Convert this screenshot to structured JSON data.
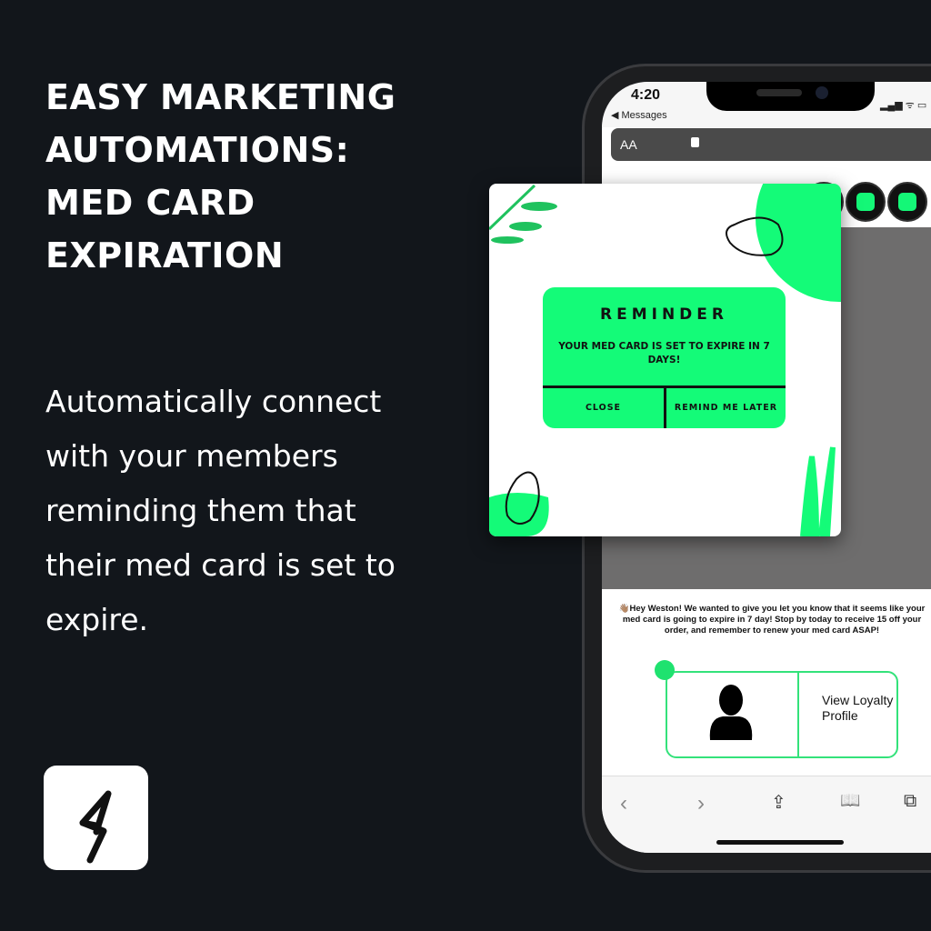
{
  "headline": {
    "lines": [
      "Easy Marketing",
      "Automations:",
      "Med Card",
      "Expiration"
    ]
  },
  "body": "Automatically connect with your members reminding them that their med card is set to expire.",
  "logo": {
    "icon": "lightning-bolt-icon"
  },
  "phone": {
    "status": {
      "time": "4:20",
      "back": "◀ Messages",
      "signal": "▂▄▆ ᯤ ▭"
    },
    "urlbar": {
      "text_size": "AA",
      "icon": "lock-icon"
    },
    "social_icons": [
      "facebook-icon",
      "instagram-icon",
      "cart-icon"
    ],
    "message": "👋🏽Hey Weston! We wanted to give you let you know that it seems like your med card is going to expire in 7 day! Stop by today to receive 15 off your order, and remember to renew your med card ASAP!",
    "loyalty": {
      "label": "View Loyalty Profile"
    },
    "toolbar": {
      "back": "‹",
      "forward": "›",
      "share": "⇪",
      "bookmarks": "📖",
      "tabs": "⧉"
    }
  },
  "popup": {
    "title": "REMINDER",
    "body": "YOUR MED CARD IS SET TO EXPIRE IN 7 DAYS!",
    "close": "CLOSE",
    "later": "REMIND ME LATER"
  },
  "colors": {
    "background": "#12161b",
    "accent": "#14fb78"
  }
}
